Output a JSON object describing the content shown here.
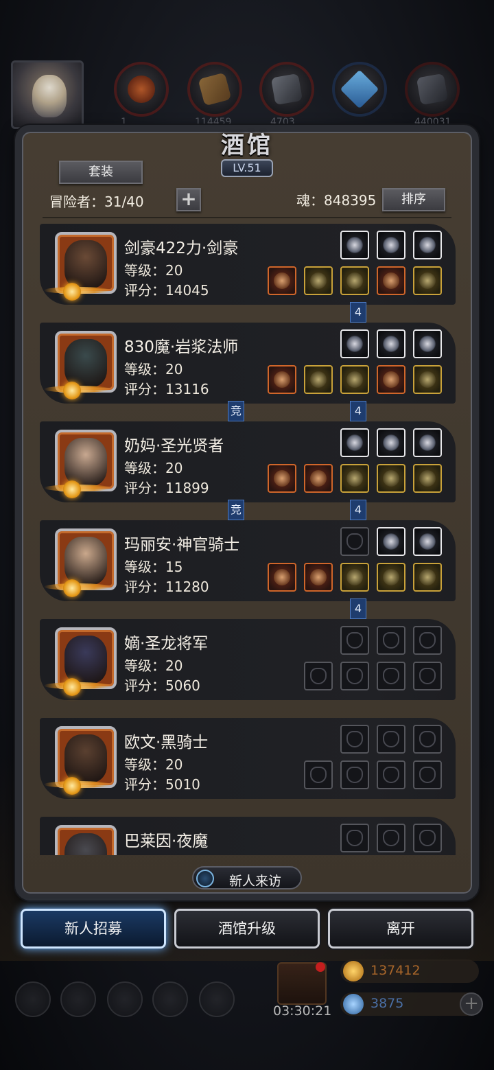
{
  "panel": {
    "title": "酒馆",
    "level": "LV.51",
    "suit_label": "套装",
    "adventurers_label": "冒险者：31/40",
    "soul_label": "魂：848395",
    "sort_label": "排序",
    "plus_symbol": "+"
  },
  "resources": [
    "1…",
    "114459",
    "4703…",
    "…",
    "440031"
  ],
  "heroes": [
    {
      "name": "剑豪422力·剑豪",
      "level": "等级：20",
      "score": "评分：14045",
      "face": "#6a4a36",
      "top_slots": [
        "white",
        "white",
        "white"
      ],
      "bottom_slots": [
        "orange",
        "gold",
        "gold",
        "orange",
        "gold"
      ]
    },
    {
      "name": "830魔·岩浆法师",
      "level": "等级：20",
      "score": "评分：13116",
      "face": "#3a4a4c",
      "top_slots": [
        "white",
        "white",
        "white"
      ],
      "bottom_slots": [
        "orange",
        "gold",
        "gold",
        "orange",
        "gold"
      ]
    },
    {
      "name": "奶妈·圣光贤者",
      "level": "等级：20",
      "score": "评分：11899",
      "face": "#c8a890",
      "top_slots": [
        "white",
        "white",
        "white"
      ],
      "bottom_slots": [
        "orange",
        "orange",
        "gold",
        "gold",
        "gold"
      ]
    },
    {
      "name": "玛丽安·神官骑士",
      "level": "等级：15",
      "score": "评分：11280",
      "face": "#caa88c",
      "top_slots": [
        "empty",
        "white",
        "white"
      ],
      "bottom_slots": [
        "orange",
        "orange",
        "gold",
        "gold",
        "gold"
      ]
    },
    {
      "name": "嫡·圣龙将军",
      "level": "等级：20",
      "score": "评分：5060",
      "face": "#3a3a5a",
      "top_slots": [
        "empty",
        "empty",
        "empty"
      ],
      "bottom_slots": [
        "empty",
        "empty",
        "empty",
        "empty"
      ]
    },
    {
      "name": "欧文·黑骑士",
      "level": "等级：20",
      "score": "评分：5010",
      "face": "#5a4030",
      "top_slots": [
        "empty",
        "empty",
        "empty"
      ],
      "bottom_slots": [
        "empty",
        "empty",
        "empty",
        "empty"
      ]
    },
    {
      "name": "巴莱因·夜魔",
      "level": "",
      "score": "",
      "face": "#4a4a50",
      "top_slots": [
        "empty",
        "empty",
        "empty"
      ],
      "bottom_slots": []
    }
  ],
  "links": {
    "count_tag": "4",
    "arena_tag": "竞"
  },
  "bottom": {
    "visit_label": "新人来访",
    "recruit_label": "新人招募",
    "upgrade_label": "酒馆升级",
    "leave_label": "离开",
    "timer": "03:30:21",
    "gold": "137412",
    "gems": "3875",
    "add_symbol": "+"
  },
  "colors": {
    "accent_blue": "#6fb3ff",
    "card_bg": "#1f2024",
    "panel_bg": "#453c31"
  }
}
